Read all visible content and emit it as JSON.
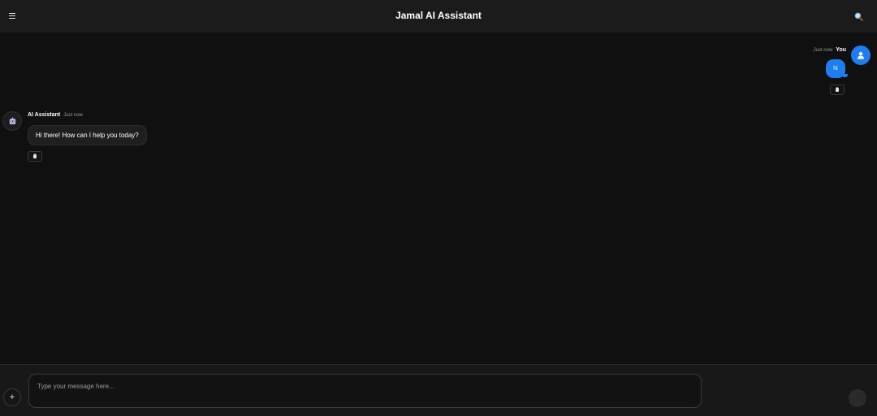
{
  "header": {
    "title": "Jamal AI Assistant",
    "menu_icon": "hamburger-menu-icon",
    "search_icon": "search-icon"
  },
  "messages": [
    {
      "role": "user",
      "sender": "You",
      "time": "Just now",
      "text": "hi",
      "avatar_icon": "user-silhouette-icon",
      "action_icon": "clipboard-icon"
    },
    {
      "role": "assistant",
      "sender": "AI Assistant",
      "time": "Just now",
      "text": "Hi there! How can I help you today?",
      "avatar_icon": "robot-icon",
      "action_icon": "clipboard-icon"
    }
  ],
  "composer": {
    "placeholder": "Type your message here...",
    "attach_label": "+",
    "send_icon": "send-icon"
  },
  "colors": {
    "background": "#101010",
    "header": "#1b1b1b",
    "accent": "#1e7df0",
    "assistant_bubble": "#1f1f1f"
  }
}
